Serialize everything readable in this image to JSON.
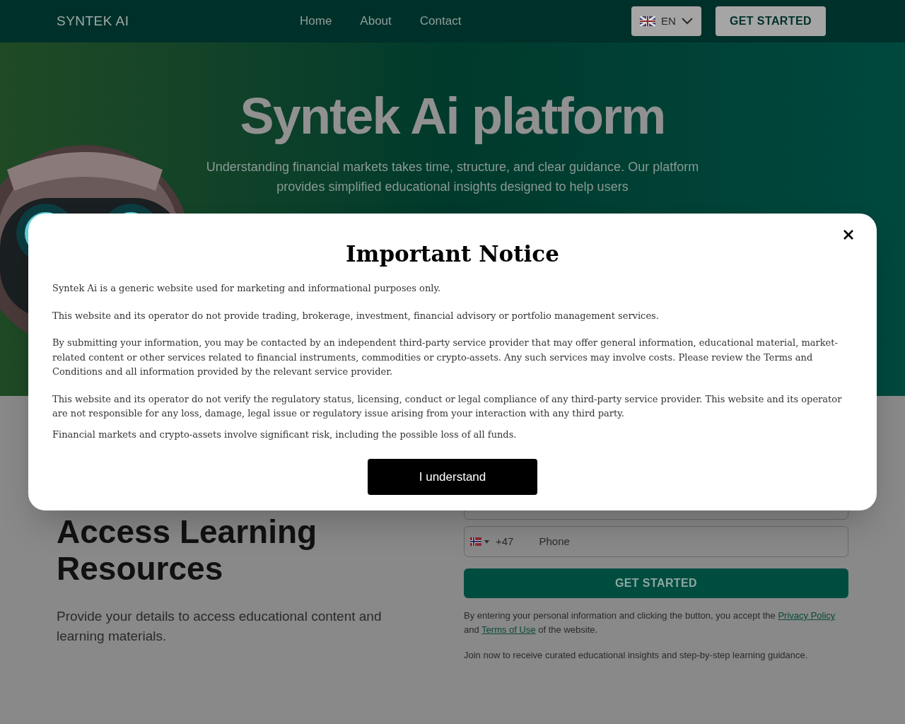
{
  "header": {
    "logo": "SYNTEK AI",
    "nav": [
      {
        "label": "Home"
      },
      {
        "label": "About"
      },
      {
        "label": "Contact"
      }
    ],
    "language": "EN",
    "cta": "GET STARTED"
  },
  "hero": {
    "title": "Syntek Ai platform",
    "text": "Understanding financial markets takes time, structure, and clear guidance. Our platform provides simplified educational insights designed to help users"
  },
  "signup": {
    "heading": "Access Learning Resources",
    "text": "Provide your details to access educational content and learning materials.",
    "phone": {
      "code": "+47",
      "placeholder": "Phone"
    },
    "button": "GET STARTED",
    "consent": {
      "before": "By entering your personal information and clicking the button, you accept the ",
      "link1": "Privacy Policy",
      "middle": " and ",
      "link2": "Terms of Use",
      "after": " of the website."
    },
    "note": "Join now to receive curated educational insights and step-by-step learning guidance."
  },
  "modal": {
    "title": "Important Notice",
    "paragraphs": [
      "Syntek Ai is a generic website used for marketing and informational purposes only.",
      "This website and its operator do not provide trading, brokerage, investment, financial advisory or portfolio management services.",
      "By submitting your information, you may be contacted by an independent third-party service provider that may offer general information, educational material, market-related content or other services related to financial instruments, commodities or crypto-assets. Any such services may involve costs. Please review the Terms and Conditions and all information provided by the relevant service provider.",
      "This website and its operator do not verify the regulatory status, licensing, conduct or legal compliance of any third-party service provider. This website and its operator are not responsible for any loss, damage, legal issue or regulatory issue arising from your interaction with any third party.",
      "Financial markets and crypto-assets involve significant risk, including the possible loss of all funds."
    ],
    "button": "I understand"
  }
}
